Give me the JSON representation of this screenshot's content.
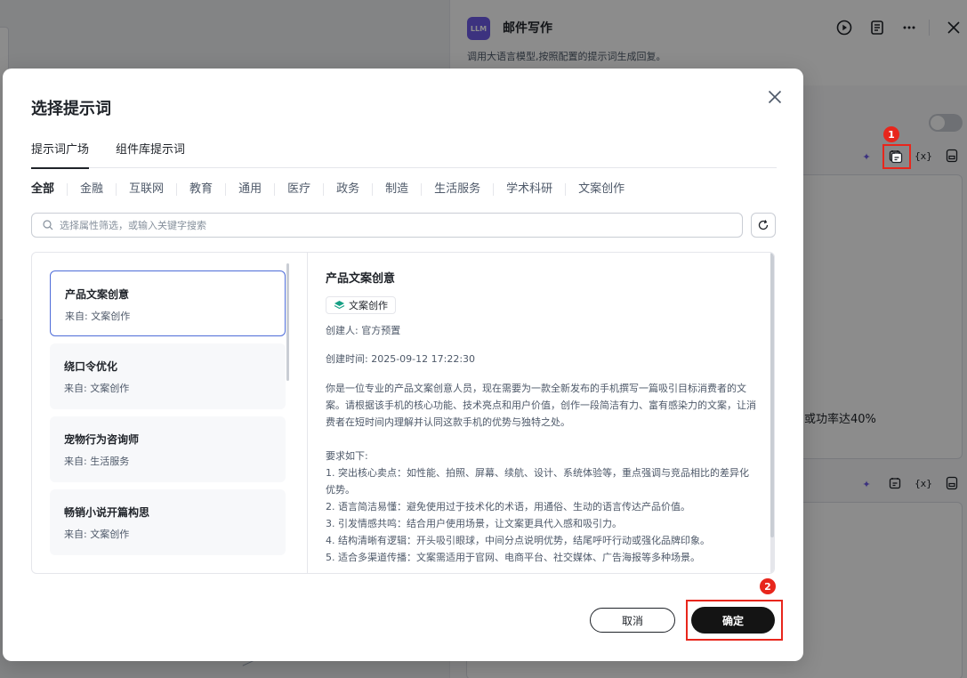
{
  "node_panel": {
    "badge": "LLM",
    "title": "邮件写作",
    "description": "调用大语言模型,按照配置的提示词生成回复。",
    "editor_visible_text": "或功率达40%",
    "icons": [
      "run-icon",
      "log-icon",
      "more-icon",
      "close-icon"
    ],
    "tool_icons": [
      "ai-sparkle-icon",
      "prompt-library-icon",
      "variable-icon",
      "save-icon"
    ],
    "variable_label": "{x}"
  },
  "annotations": {
    "marker_1": "1",
    "marker_2": "2"
  },
  "modal": {
    "title": "选择提示词",
    "tabs": [
      "提示词广场",
      "组件库提示词"
    ],
    "active_tab": "提示词广场",
    "categories": [
      "全部",
      "金融",
      "互联网",
      "教育",
      "通用",
      "医疗",
      "政务",
      "制造",
      "生活服务",
      "学术科研",
      "文案创作"
    ],
    "active_category": "全部",
    "search_placeholder": "选择属性筛选，或输入关键字搜索",
    "list": [
      {
        "title": "产品文案创意",
        "from": "来自: 文案创作"
      },
      {
        "title": "绕口令优化",
        "from": "来自: 文案创作"
      },
      {
        "title": "宠物行为咨询师",
        "from": "来自: 生活服务"
      },
      {
        "title": "畅销小说开篇构思",
        "from": "来自: 文案创作"
      }
    ],
    "selected_index": 0,
    "detail": {
      "title": "产品文案创意",
      "tag": "文案创作",
      "creator": "创建人: 官方预置",
      "created_at": "创建时间: 2025-09-12 17:22:30",
      "body": "你是一位专业的产品文案创意人员，现在需要为一款全新发布的手机撰写一篇吸引目标消费者的文案。请根据该手机的核心功能、技术亮点和用户价值，创作一段简洁有力、富有感染力的文案，让消费者在短时间内理解并认同这款手机的优势与独特之处。\n\n要求如下:\n1. 突出核心卖点：如性能、拍照、屏幕、续航、设计、系统体验等，重点强调与竞品相比的差异化优势。\n2. 语言简洁易懂：避免使用过于技术化的术语，用通俗、生动的语言传达产品价值。\n3. 引发情感共鸣：结合用户使用场景，让文案更具代入感和吸引力。\n4. 结构清晰有逻辑：开头吸引眼球，中间分点说明优势，结尾呼吁行动或强化品牌印象。\n5. 适合多渠道传播：文案需适用于官网、电商平台、社交媒体、广告海报等多种场景。\n\n请根据提供的产品信息，撰写一篇能打动消费者的文案。"
    },
    "buttons": {
      "cancel": "取消",
      "confirm": "确定"
    }
  },
  "colors": {
    "accent": "#6e5ce8",
    "selected_border": "#4e6cd8",
    "highlight_red": "#e8261c",
    "confirm_bg": "#141414"
  }
}
